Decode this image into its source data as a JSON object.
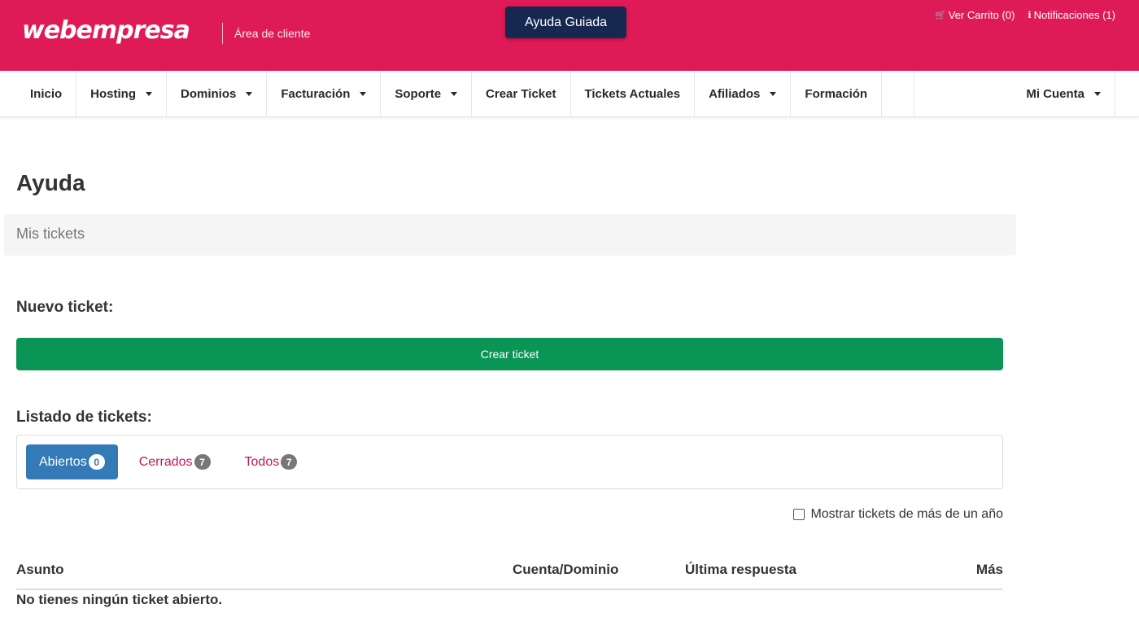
{
  "header": {
    "logo_text": "webempresa",
    "subtitle": "Área de cliente",
    "guide_button": "Ayuda Guiada",
    "cart_label": "Ver Carrito (0)",
    "notifications_label": "Notificaciones (1)",
    "accent_color": "#df1b57"
  },
  "nav": {
    "items": [
      {
        "label": "Inicio",
        "dropdown": false
      },
      {
        "label": "Hosting",
        "dropdown": true
      },
      {
        "label": "Dominios",
        "dropdown": true
      },
      {
        "label": "Facturación",
        "dropdown": true
      },
      {
        "label": "Soporte",
        "dropdown": true
      },
      {
        "label": "Crear Ticket",
        "dropdown": false
      },
      {
        "label": "Tickets Actuales",
        "dropdown": false
      },
      {
        "label": "Afiliados",
        "dropdown": true
      },
      {
        "label": "Formación",
        "dropdown": false
      }
    ],
    "account": "Mi Cuenta"
  },
  "main": {
    "title": "Ayuda",
    "breadcrumb": "Mis tickets",
    "new_ticket_heading": "Nuevo ticket:",
    "create_button": "Crear ticket",
    "list_heading": "Listado de tickets:",
    "tabs": [
      {
        "label": "Abiertos",
        "count": "0",
        "active": true
      },
      {
        "label": "Cerrados",
        "count": "7",
        "active": false
      },
      {
        "label": "Todos",
        "count": "7",
        "active": false
      }
    ],
    "show_old_label": "Mostrar tickets de más de un año",
    "show_old_checked": false,
    "table": {
      "columns": [
        "Asunto",
        "Cuenta/Dominio",
        "Última respuesta",
        "Más"
      ],
      "empty_message": "No tienes ningún ticket abierto."
    }
  },
  "colors": {
    "create_button": "#0a9455",
    "active_tab": "#337ab7",
    "guide_button": "#16284f"
  }
}
